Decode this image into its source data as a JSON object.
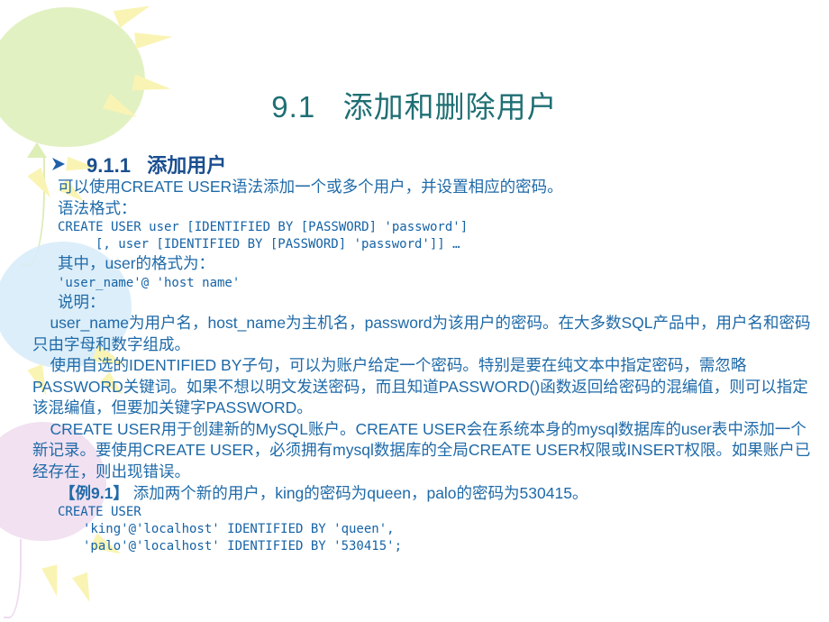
{
  "slide": {
    "title": "9.1   添加和删除用户",
    "title_color": "#1f6f73",
    "body_color": "#1f6aa8",
    "heading_color": "#1a4f8f",
    "code_color": "#1663a6",
    "background": "#ffffff"
  },
  "section": {
    "bullet_icon": "chevron-right-icon",
    "heading": "9.1.1   添加用户"
  },
  "body": {
    "p1": "可以使用CREATE USER语法添加一个或多个用户，并设置相应的密码。",
    "p2": "语法格式：",
    "code1": "CREATE USER user [IDENTIFIED BY [PASSWORD] 'password']",
    "code2": "[, user [IDENTIFIED BY [PASSWORD] 'password']] …",
    "p3": "其中，user的格式为：",
    "code3": "'user_name'@ 'host name'",
    "p4": "说明：",
    "p5": "    user_name为用户名，host_name为主机名，password为该用户的密码。在大多数SQL产品中，用户名和密码只由字母和数字组成。",
    "p6": "    使用自选的IDENTIFIED BY子句，可以为账户给定一个密码。特别是要在纯文本中指定密码，需忽略PASSWORD关键词。如果不想以明文发送密码，而且知道PASSWORD()函数返回给密码的混编值，则可以指定该混编值，但要加关键字PASSWORD。",
    "p7": "    CREATE USER用于创建新的MySQL账户。CREATE USER会在系统本身的mysql数据库的user表中添加一个新记录。要使用CREATE USER，必须拥有mysql数据库的全局CREATE USER权限或INSERT权限。如果账户已经存在，则出现错误。"
  },
  "example": {
    "label": "【例9.1】",
    "text": " 添加两个新的用户，king的密码为queen，palo的密码为530415。",
    "code1": "CREATE USER",
    "code2": "'king'@'localhost' IDENTIFIED BY 'queen',",
    "code3": "'palo'@'localhost' IDENTIFIED BY '530415';"
  },
  "decorations": {
    "balloon_green": "#ddeeb7",
    "balloon_blue": "#d8ecf8",
    "balloon_pink": "#eedcef",
    "ray_yellow": "#faf4b4"
  }
}
